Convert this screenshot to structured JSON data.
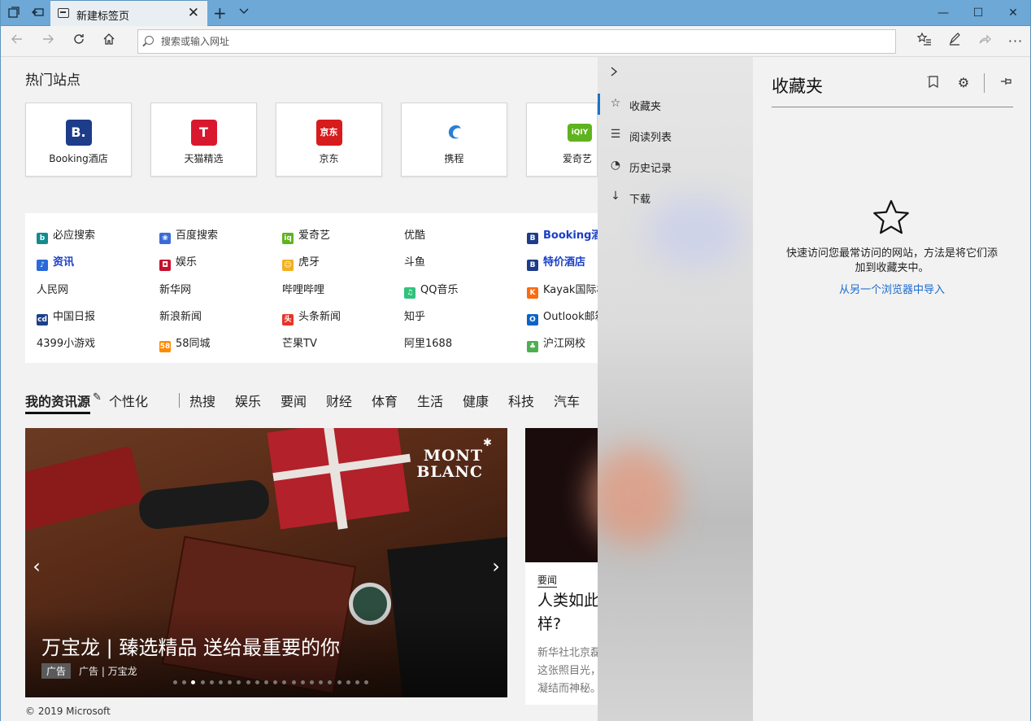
{
  "window": {
    "tab_title": "新建标签页",
    "new_tab": "+",
    "minimize": "—",
    "maximize": "☐",
    "close": "✕",
    "tab_close": "✕"
  },
  "navbar": {
    "address_placeholder": "搜索或输入网址"
  },
  "top_sites": {
    "title": "热门站点",
    "tiles": [
      {
        "label": "Booking酒店",
        "logo_text": "B.",
        "color": "#1d3c8a"
      },
      {
        "label": "天猫精选",
        "logo_text": "T",
        "color": "#d9182f"
      },
      {
        "label": "京东",
        "logo_text": "京东",
        "color": "#d71c1e"
      },
      {
        "label": "携程",
        "logo_text": "",
        "color": "#2a7fd4"
      },
      {
        "label": "爱奇艺",
        "logo_text": "iQIY",
        "color": "#5fb31e"
      }
    ]
  },
  "quick_links": {
    "rows": [
      [
        {
          "label": "必应搜索",
          "icon": "bing-icon",
          "color": "#138b8e",
          "glyph": "b"
        },
        {
          "label": "百度搜索",
          "icon": "baidu-icon",
          "color": "#3a6bd9",
          "glyph": "❀"
        },
        {
          "label": "爱奇艺",
          "icon": "iqiyi-icon",
          "color": "#5fb31e",
          "glyph": "iq"
        },
        {
          "label": "优酷",
          "icon": "",
          "color": "",
          "glyph": ""
        },
        {
          "label": "Booking酒店",
          "icon": "booking-icon",
          "color": "#1d3c8a",
          "glyph": "B",
          "highlight": true
        }
      ],
      [
        {
          "label": "资讯",
          "icon": "news-icon",
          "color": "#2a6ad9",
          "glyph": "♪",
          "highlight": true
        },
        {
          "label": "娱乐",
          "icon": "ent-icon",
          "color": "#c8102e",
          "glyph": "◘"
        },
        {
          "label": "虎牙",
          "icon": "huya-icon",
          "color": "#f2b01e",
          "glyph": "☺"
        },
        {
          "label": "斗鱼",
          "icon": "",
          "color": "",
          "glyph": ""
        },
        {
          "label": "特价酒店",
          "icon": "booking-icon",
          "color": "#1d3c8a",
          "glyph": "B",
          "highlight": true
        }
      ],
      [
        {
          "label": "人民网",
          "icon": "",
          "color": "",
          "glyph": ""
        },
        {
          "label": "新华网",
          "icon": "",
          "color": "",
          "glyph": ""
        },
        {
          "label": "哔哩哔哩",
          "icon": "",
          "color": "",
          "glyph": ""
        },
        {
          "label": "QQ音乐",
          "icon": "qqmusic-icon",
          "color": "#31c27c",
          "glyph": "♫"
        },
        {
          "label": "Kayak国际机",
          "icon": "kayak-icon",
          "color": "#ff690f",
          "glyph": "K"
        }
      ],
      [
        {
          "label": "中国日报",
          "icon": "chinadaily-icon",
          "color": "#1b3f8b",
          "glyph": "cd"
        },
        {
          "label": "新浪新闻",
          "icon": "",
          "color": "",
          "glyph": ""
        },
        {
          "label": "头条新闻",
          "icon": "toutiao-icon",
          "color": "#e8332a",
          "glyph": "头"
        },
        {
          "label": "知乎",
          "icon": "",
          "color": "",
          "glyph": ""
        },
        {
          "label": "Outlook邮箱",
          "icon": "outlook-icon",
          "color": "#0a64c8",
          "glyph": "O"
        }
      ],
      [
        {
          "label": "4399小游戏",
          "icon": "",
          "color": "",
          "glyph": ""
        },
        {
          "label": "58同城",
          "icon": "58-icon",
          "color": "#ff8a00",
          "glyph": "58"
        },
        {
          "label": "芒果TV",
          "icon": "",
          "color": "",
          "glyph": ""
        },
        {
          "label": "阿里1688",
          "icon": "",
          "color": "",
          "glyph": ""
        },
        {
          "label": "沪江网校",
          "icon": "hujiang-icon",
          "color": "#4caf50",
          "glyph": "♣"
        }
      ]
    ]
  },
  "feed": {
    "tabs": [
      "我的资讯源",
      "个性化",
      "热搜",
      "娱乐",
      "要闻",
      "财经",
      "体育",
      "生活",
      "健康",
      "科技",
      "汽车"
    ],
    "hero": {
      "title": "万宝龙 | 臻选精品 送给最重要的你",
      "ad_tag": "广告",
      "source": "广告 | 万宝龙",
      "brand_line1": "MONT",
      "brand_line2": "BLANC",
      "dots": 22,
      "active_dot": 2
    },
    "card": {
      "category": "要闻",
      "title": "人类如此样?",
      "body": "新华社北京磊）这张照目光，凝结而神秘。"
    }
  },
  "footer": "© 2019 Microsoft",
  "hub": {
    "nav_items": [
      "收藏夹",
      "阅读列表",
      "历史记录",
      "下载"
    ],
    "panel_title": "收藏夹",
    "empty_message": "快速访问您最常访问的网站，方法是将它们添加到收藏夹中。",
    "import_link": "从另一个浏览器中导入"
  },
  "colors": {
    "titlebar": "#6da8d6",
    "accent": "#1a73c8",
    "link": "#1a6ad0",
    "highlight_link": "#1a3ec8"
  }
}
